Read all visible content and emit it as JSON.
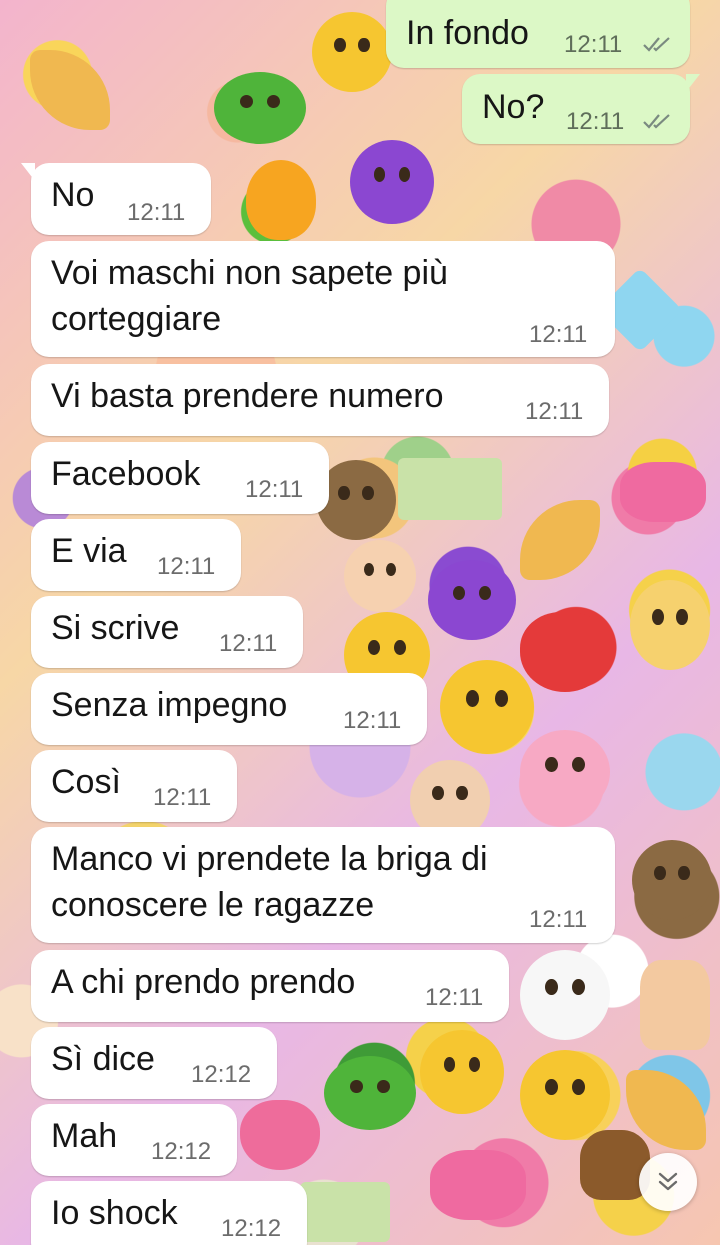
{
  "conversation": {
    "messages": [
      {
        "direction": "out",
        "text": "In fondo",
        "time": "12:11",
        "status": "read"
      },
      {
        "direction": "out",
        "text": "No?",
        "time": "12:11",
        "status": "read"
      },
      {
        "direction": "in",
        "text": "No",
        "time": "12:11"
      },
      {
        "direction": "in",
        "text": "Voi maschi non sapete più\ncorteggiare",
        "time": "12:11"
      },
      {
        "direction": "in",
        "text": "Vi basta prendere numero",
        "time": "12:11"
      },
      {
        "direction": "in",
        "text": "Facebook",
        "time": "12:11"
      },
      {
        "direction": "in",
        "text": "E via",
        "time": "12:11"
      },
      {
        "direction": "in",
        "text": "Si scrive",
        "time": "12:11"
      },
      {
        "direction": "in",
        "text": "Senza impegno",
        "time": "12:11"
      },
      {
        "direction": "in",
        "text": "Così",
        "time": "12:11"
      },
      {
        "direction": "in",
        "text": "Manco vi prendete la briga di\nconoscere le ragazze",
        "time": "12:11"
      },
      {
        "direction": "in",
        "text": "A chi prendo prendo",
        "time": "12:11"
      },
      {
        "direction": "in",
        "text": "Sì dice",
        "time": "12:12"
      },
      {
        "direction": "in",
        "text": "Mah",
        "time": "12:12"
      },
      {
        "direction": "in",
        "text": "Io shock",
        "time": "12:12"
      }
    ]
  },
  "icons": {
    "read_receipt": "double-check-icon",
    "scroll_down": "chevron-double-down-icon"
  },
  "colors": {
    "incoming_bubble": "#ffffff",
    "outgoing_bubble": "#dcf8c6",
    "read_tick": "#7a8a80"
  }
}
